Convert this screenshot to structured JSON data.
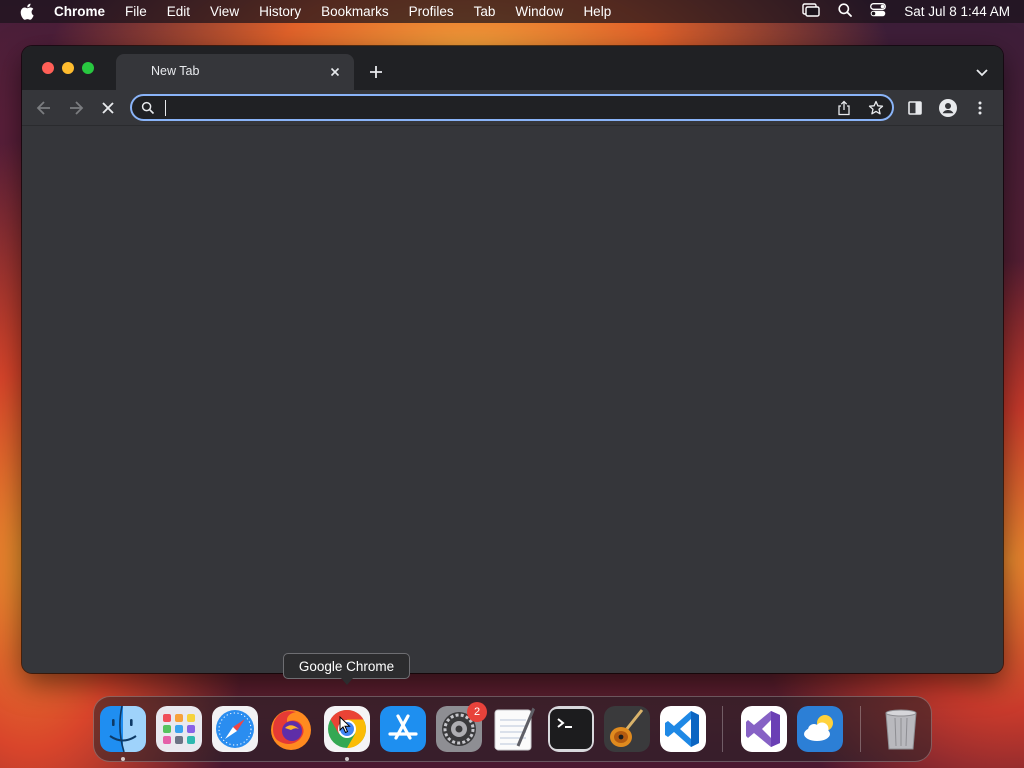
{
  "menubar": {
    "app_name": "Chrome",
    "items": [
      "File",
      "Edit",
      "View",
      "History",
      "Bookmarks",
      "Profiles",
      "Tab",
      "Window",
      "Help"
    ],
    "clock": "Sat Jul 8  1:44 AM"
  },
  "browser": {
    "tab_title": "New Tab",
    "omnibox_value": "",
    "accent_color": "#8ab4f8"
  },
  "dock": {
    "tooltip": "Google Chrome",
    "settings_badge": "2",
    "apps": [
      "Finder",
      "Launchpad",
      "Safari",
      "Firefox",
      "Google Chrome",
      "App Store",
      "System Settings",
      "TextEdit",
      "Terminal",
      "GarageBand",
      "Visual Studio Code",
      "Visual Studio",
      "Weather",
      "Trash"
    ]
  }
}
